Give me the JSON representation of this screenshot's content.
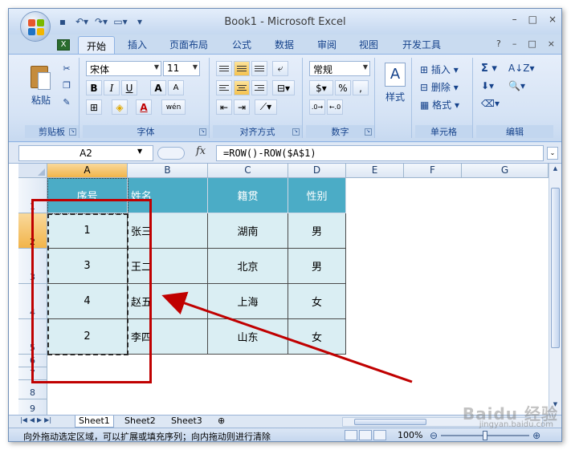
{
  "window": {
    "title": "Book1 - Microsoft Excel",
    "controls": [
      "–",
      "□",
      "×"
    ],
    "doc_controls": [
      "?",
      "–",
      "□",
      "×"
    ]
  },
  "qat": [
    "save-icon",
    "undo-icon",
    "redo-icon",
    "customize-icon"
  ],
  "tabs": [
    {
      "label": "开始",
      "active": true
    },
    {
      "label": "插入"
    },
    {
      "label": "页面布局"
    },
    {
      "label": "公式"
    },
    {
      "label": "数据"
    },
    {
      "label": "审阅"
    },
    {
      "label": "视图"
    },
    {
      "label": "开发工具"
    }
  ],
  "ribbon": {
    "clipboard": {
      "label": "剪贴板",
      "paste": "粘贴"
    },
    "font": {
      "label": "字体",
      "name": "宋体",
      "size": "11",
      "bold": "B",
      "italic": "I",
      "underline": "U",
      "grow": "A",
      "shrink": "A",
      "color_a": "A",
      "wen": "wén"
    },
    "alignment": {
      "label": "对齐方式"
    },
    "number": {
      "label": "数字",
      "format": "常规",
      "percent": "%",
      "comma": ","
    },
    "styles": {
      "label": "样式"
    },
    "cells": {
      "label": "单元格",
      "insert": "插入",
      "delete": "删除",
      "format": "格式"
    },
    "editing": {
      "label": "编辑",
      "sigma": "Σ"
    }
  },
  "formula_bar": {
    "name_box": "A2",
    "fx": "fx",
    "formula": "=ROW()-ROW($A$1)"
  },
  "columns": [
    "A",
    "B",
    "C",
    "D",
    "E",
    "F",
    "G"
  ],
  "rows": [
    "1",
    "2",
    "3",
    "4",
    "5",
    "6",
    "7",
    "8",
    "9"
  ],
  "table": {
    "headers": [
      "序号",
      "姓名",
      "籍贯",
      "性别"
    ],
    "rows": [
      [
        "1",
        "张三",
        "湖南",
        "男"
      ],
      [
        "3",
        "王二",
        "北京",
        "男"
      ],
      [
        "4",
        "赵五",
        "上海",
        "女"
      ],
      [
        "2",
        "李四",
        "山东",
        "女"
      ]
    ]
  },
  "sheets": [
    "Sheet1",
    "Sheet2",
    "Sheet3"
  ],
  "status": {
    "message": "向外拖动选定区域，可以扩展或填充序列；向内拖动则进行清除",
    "zoom": "100%"
  },
  "watermark": {
    "logo": "Baidu 经验",
    "url": "jingyan.baidu.com"
  },
  "colors": {
    "table_header": "#4bacc6",
    "table_body": "#daeef3",
    "annotation": "#c00000",
    "selected_header": "#f2b44a"
  }
}
